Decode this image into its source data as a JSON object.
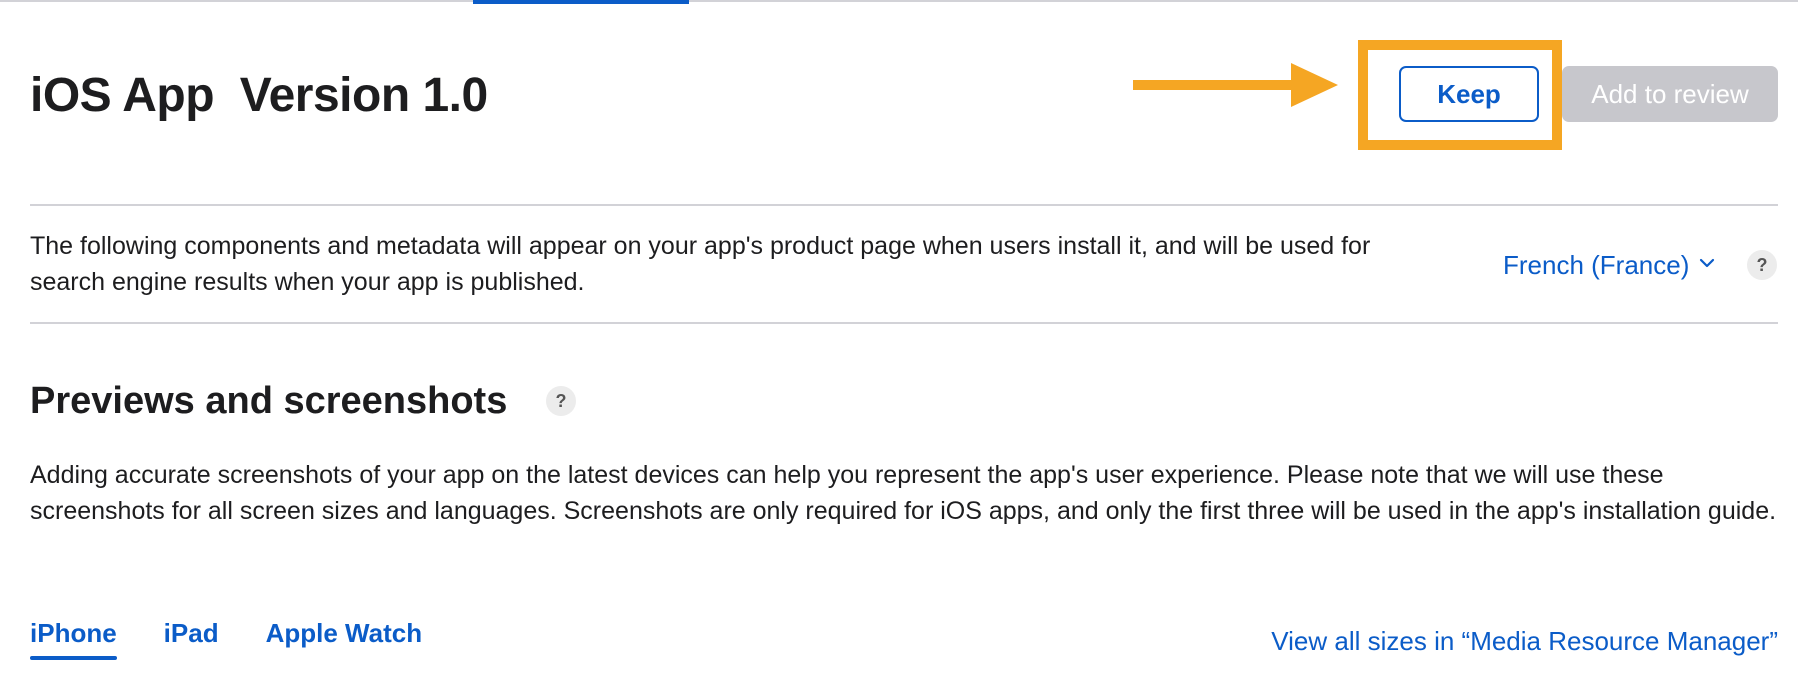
{
  "header": {
    "title": "iOS App  Version 1.0",
    "keep_label": "Keep",
    "add_to_review_label": "Add to review"
  },
  "intro": {
    "text": "The following components and metadata will appear on your app's product page when users install it, and will be used for search engine results when your app is published."
  },
  "language": {
    "selected": "French (France)",
    "icon": "chevron-down-icon"
  },
  "help": {
    "symbol": "?"
  },
  "previews": {
    "title": "Previews and screenshots",
    "description": "Adding accurate screenshots of your app on the latest devices can help you represent the app's user experience. Please note that we will use these screenshots for all screen sizes and languages. Screenshots are only required for iOS apps, and only the first three will be used in the app's installation guide.",
    "tabs": [
      {
        "label": "iPhone",
        "active": true
      },
      {
        "label": "iPad",
        "active": false
      },
      {
        "label": "Apple Watch",
        "active": false
      }
    ],
    "view_all_link": "View all sizes in “Media Resource Manager”"
  },
  "colors": {
    "accent": "#0b5cc8",
    "annotation": "#f5a623",
    "disabled_button": "#c7c7cc",
    "divider": "#d2d2d7"
  }
}
